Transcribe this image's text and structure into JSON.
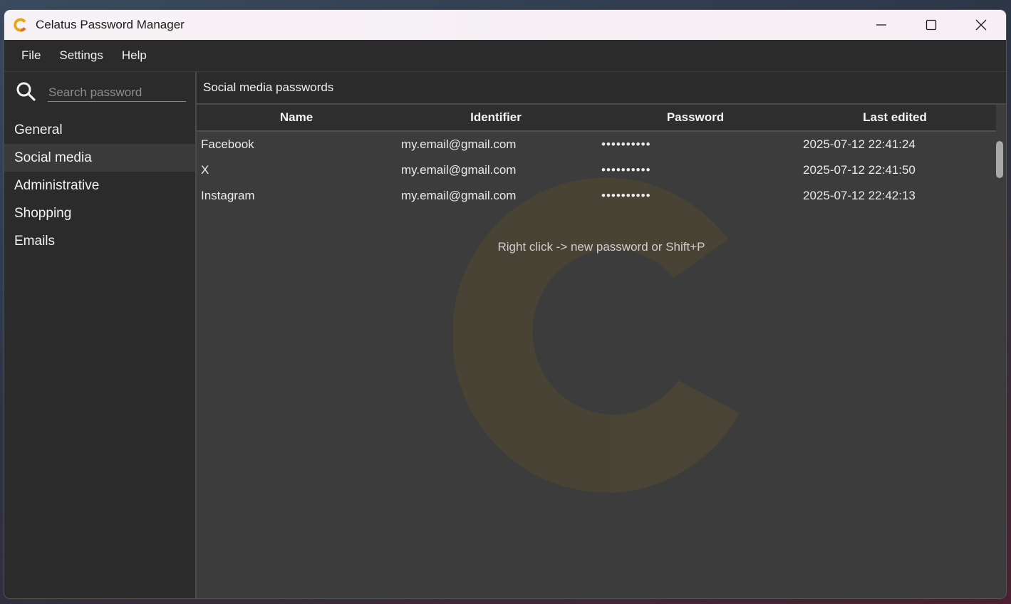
{
  "window": {
    "title": "Celatus Password Manager"
  },
  "menu": {
    "items": [
      "File",
      "Settings",
      "Help"
    ]
  },
  "search": {
    "placeholder": "Search password"
  },
  "categories": [
    {
      "label": "General",
      "active": false
    },
    {
      "label": "Social media",
      "active": true
    },
    {
      "label": "Administrative",
      "active": false
    },
    {
      "label": "Shopping",
      "active": false
    },
    {
      "label": "Emails",
      "active": false
    }
  ],
  "main": {
    "header": "Social media passwords",
    "columns": [
      "Name",
      "Identifier",
      "Password",
      "Last edited"
    ],
    "rows": [
      {
        "name": "Facebook",
        "identifier": "my.email@gmail.com",
        "password": "••••••••••",
        "last_edited": "2025-07-12 22:41:24"
      },
      {
        "name": "X",
        "identifier": "my.email@gmail.com",
        "password": "••••••••••",
        "last_edited": "2025-07-12 22:41:50"
      },
      {
        "name": "Instagram",
        "identifier": "my.email@gmail.com",
        "password": "••••••••••",
        "last_edited": "2025-07-12 22:42:13"
      }
    ],
    "hint": "Right click -> new password or Shift+P"
  },
  "colors": {
    "accent": "#e8a317",
    "accent_dark": "#e06c1a",
    "window_bg": "#2b2b2b",
    "panel_bg": "#3c3c3c"
  },
  "icons": {
    "app": "celatus-c-logo-icon",
    "minimize": "minimize-icon",
    "maximize": "maximize-icon",
    "close": "close-icon",
    "search": "search-icon",
    "watermark": "celatus-c-watermark-icon"
  }
}
